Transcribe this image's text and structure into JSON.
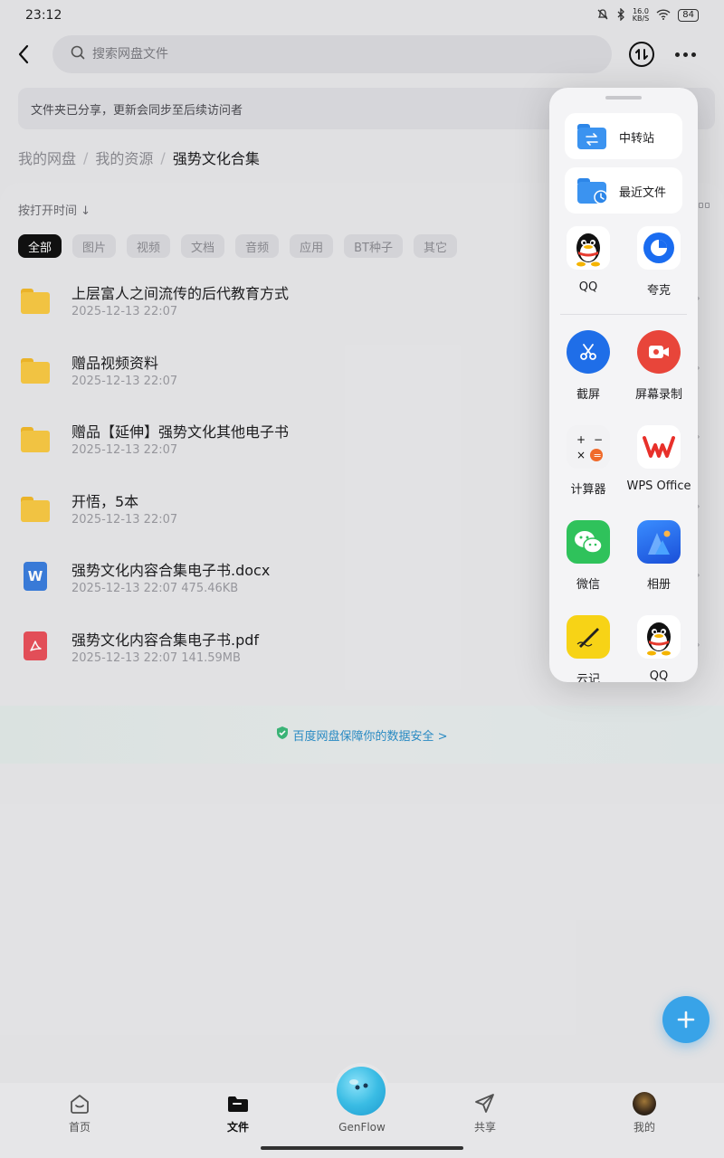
{
  "status": {
    "time": "23:12",
    "netspeed_top": "16.0",
    "netspeed_bottom": "KB/S",
    "battery": "84"
  },
  "search": {
    "placeholder": "搜索网盘文件"
  },
  "notice": "文件夹已分享，更新会同步至后续访问者",
  "breadcrumb": [
    "我的网盘",
    "我的资源",
    "强势文化合集"
  ],
  "sort_label": "按打开时间 ↓",
  "chips": [
    "全部",
    "图片",
    "视频",
    "文档",
    "音频",
    "应用",
    "BT种子",
    "其它"
  ],
  "files": [
    {
      "name": "上层富人之间流传的后代教育方式",
      "meta": "2025-12-13  22:07",
      "type": "folder"
    },
    {
      "name": "赠品视频资料",
      "meta": "2025-12-13  22:07",
      "type": "folder"
    },
    {
      "name": "赠品【延伸】强势文化其他电子书",
      "meta": "2025-12-13  22:07",
      "type": "folder"
    },
    {
      "name": "开悟，5本",
      "meta": "2025-12-13  22:07",
      "type": "folder"
    },
    {
      "name": "强势文化内容合集电子书.docx",
      "meta": "2025-12-13  22:07   475.46KB",
      "type": "docx",
      "icon_letter": "W"
    },
    {
      "name": "强势文化内容合集电子书.pdf",
      "meta": "2025-12-13  22:07   141.59MB",
      "type": "pdf"
    }
  ],
  "safety_banner": "百度网盘保障你的数据安全 >",
  "nav": {
    "home": "首页",
    "files": "文件",
    "genflow": "GenFlow",
    "share": "共享",
    "mine": "我的"
  },
  "side_panel": {
    "pills": [
      "中转站",
      "最近文件"
    ],
    "apps": [
      {
        "label": "QQ",
        "icon": "qq-icon"
      },
      {
        "label": "夸克",
        "icon": "quark-icon"
      },
      {
        "label": "截屏",
        "icon": "screenshot-icon"
      },
      {
        "label": "屏幕录制",
        "icon": "screen-record-icon"
      },
      {
        "label": "计算器",
        "icon": "calculator-icon"
      },
      {
        "label": "WPS Office",
        "icon": "wps-icon"
      },
      {
        "label": "微信",
        "icon": "wechat-icon"
      },
      {
        "label": "相册",
        "icon": "gallery-icon"
      },
      {
        "label": "云记",
        "icon": "notes-icon"
      },
      {
        "label": "QQ",
        "icon": "qq-icon"
      }
    ]
  },
  "colors": {
    "accent_blue": "#3aa7ee",
    "folder_yellow": "#f7c844",
    "word_blue": "#3b7ddd",
    "pdf_red": "#e8505b",
    "link_blue": "#2a8ec8"
  }
}
